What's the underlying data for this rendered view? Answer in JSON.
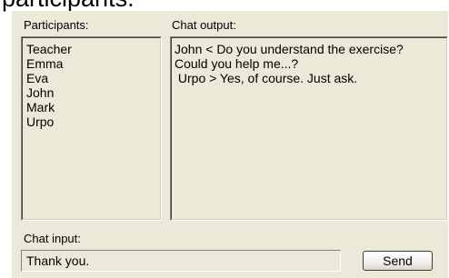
{
  "header": {
    "cut_heading": "participants."
  },
  "participants": {
    "label": "Participants:",
    "items": [
      "Teacher",
      "Emma",
      "Eva",
      "John",
      "Mark",
      "Urpo"
    ]
  },
  "chat_output": {
    "label": "Chat output:",
    "lines": [
      "John <  Do you understand the exercise?",
      "Could you help me...?",
      " Urpo > Yes, of course. Just ask."
    ]
  },
  "chat_input": {
    "label": "Chat input:",
    "value": "Thank you."
  },
  "send_button": {
    "label": "Send"
  }
}
